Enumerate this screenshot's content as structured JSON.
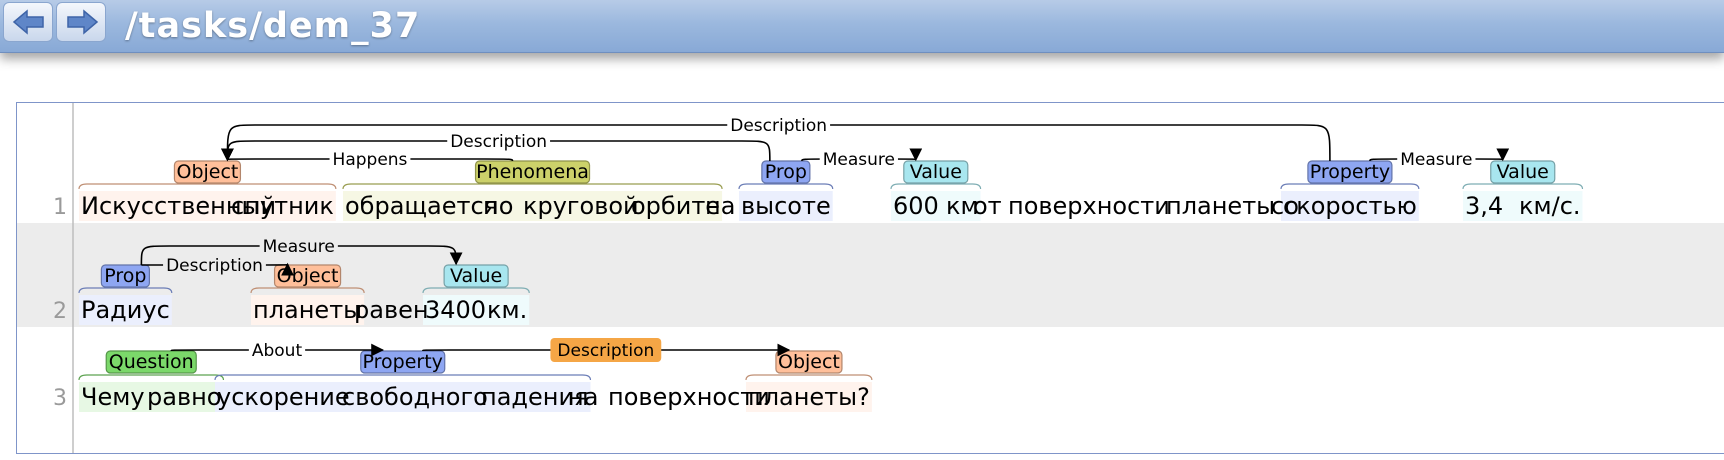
{
  "header": {
    "path": "/tasks/dem_37",
    "back_icon": "arrow-left-icon",
    "forward_icon": "arrow-right-icon"
  },
  "colors": {
    "Object": "#ffbf9a",
    "Phenomena": "#ccd16a",
    "Prop": "#8ea6f2",
    "Value": "#a8e6ef",
    "Property": "#8ea6f2",
    "Question": "#7bd86a",
    "Description": "#f5a646"
  },
  "sentences": [
    {
      "number": "1",
      "tokens": [
        "Искусственный",
        "спутник",
        "обращается",
        "по",
        "круговой",
        "орбите",
        "на",
        "высоте",
        "600",
        "км",
        "от",
        "поверхности",
        "планеты",
        "со",
        "скоростью",
        "3,4",
        "км/с."
      ],
      "entities": [
        {
          "id": "T1",
          "type": "Object",
          "text": "Искусственный спутник"
        },
        {
          "id": "T2",
          "type": "Phenomena",
          "text": "обращается по круговой орбите"
        },
        {
          "id": "T3",
          "type": "Prop",
          "text": "высоте"
        },
        {
          "id": "T4",
          "type": "Value",
          "text": "600 км"
        },
        {
          "id": "T5",
          "type": "Property",
          "text": "скоростью"
        },
        {
          "id": "T6",
          "type": "Value",
          "text": "3,4 км/с."
        }
      ],
      "relations": [
        {
          "label": "Description",
          "from": "T5",
          "to": "T1"
        },
        {
          "label": "Description",
          "from": "T3",
          "to": "T1"
        },
        {
          "label": "Happens",
          "from": "T2",
          "to": "T1"
        },
        {
          "label": "Measure",
          "from": "T3",
          "to": "T4"
        },
        {
          "label": "Measure",
          "from": "T5",
          "to": "T6"
        }
      ]
    },
    {
      "number": "2",
      "tokens": [
        "Радиус",
        "планеты",
        "равен",
        "3400",
        "км."
      ],
      "entities": [
        {
          "id": "T7",
          "type": "Prop",
          "text": "Радиус"
        },
        {
          "id": "T8",
          "type": "Object",
          "text": "планеты"
        },
        {
          "id": "T9",
          "type": "Value",
          "text": "3400 км."
        }
      ],
      "relations": [
        {
          "label": "Measure",
          "from": "T7",
          "to": "T9"
        },
        {
          "label": "Description",
          "from": "T7",
          "to": "T8"
        }
      ]
    },
    {
      "number": "3",
      "tokens": [
        "Чему",
        "равно",
        "ускорение",
        "свободного",
        "падения",
        "на",
        "поверхности",
        "планеты?"
      ],
      "entities": [
        {
          "id": "T10",
          "type": "Question",
          "text": "Чему равно"
        },
        {
          "id": "T11",
          "type": "Property",
          "text": "ускорение свободного падения"
        },
        {
          "id": "T12",
          "type": "Object",
          "text": "планеты"
        }
      ],
      "relations": [
        {
          "label": "About",
          "from": "T10",
          "to": "T11"
        },
        {
          "label": "Description",
          "from": "T11",
          "to": "T12",
          "highlighted": true
        }
      ]
    }
  ]
}
